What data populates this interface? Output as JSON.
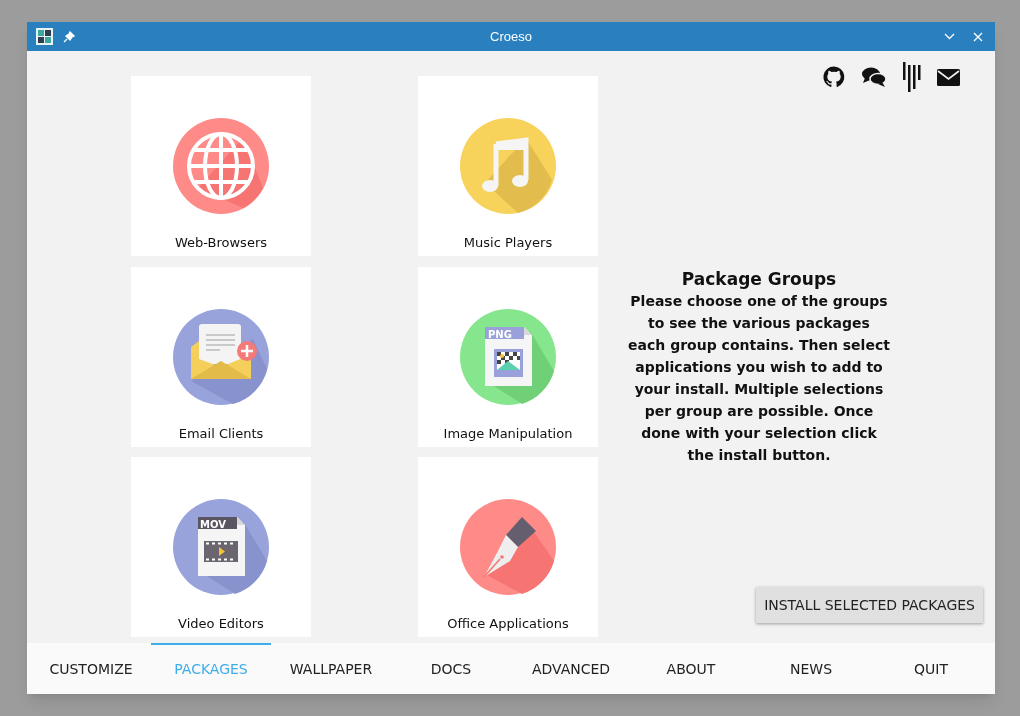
{
  "window": {
    "title": "Croeso"
  },
  "groups": [
    {
      "label": "Web-Browsers",
      "kind": "globe"
    },
    {
      "label": "Music Players",
      "kind": "music"
    },
    {
      "label": "Email Clients",
      "kind": "email"
    },
    {
      "label": "Image Manipulation",
      "kind": "png"
    },
    {
      "label": "Video Editors",
      "kind": "mov"
    },
    {
      "label": "Office Applications",
      "kind": "pen"
    }
  ],
  "file_icon_labels": [
    "PNG",
    "MOV"
  ],
  "info": {
    "heading": "Package Groups",
    "text": "Please choose one of the groups to see the various packages each group contains. Then select applications you wish to add to your install. Multiple selections per group are possible. Once done with your selection click the install button."
  },
  "install_button": "INSTALL SELECTED PACKAGES",
  "tabs": [
    {
      "label": "CUSTOMIZE",
      "selected": false
    },
    {
      "label": "PACKAGES",
      "selected": true
    },
    {
      "label": "WALLPAPER",
      "selected": false
    },
    {
      "label": "DOCS",
      "selected": false
    },
    {
      "label": "ADVANCED",
      "selected": false
    },
    {
      "label": "ABOUT",
      "selected": false
    },
    {
      "label": "NEWS",
      "selected": false
    },
    {
      "label": "QUIT",
      "selected": false
    }
  ]
}
